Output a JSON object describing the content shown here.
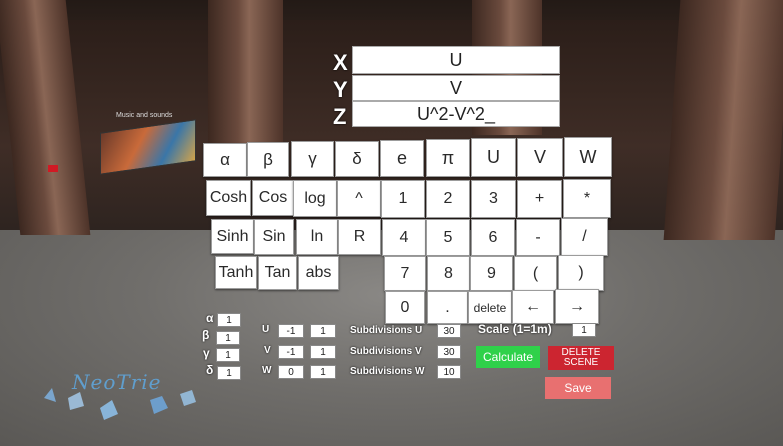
{
  "music_panel": {
    "title": "Music and sounds"
  },
  "fields": {
    "x": {
      "label": "X",
      "value": "U"
    },
    "y": {
      "label": "Y",
      "value": "V"
    },
    "z": {
      "label": "Z",
      "value": "U^2-V^2_"
    }
  },
  "keypad": {
    "row1": [
      "α",
      "β",
      "γ",
      "δ",
      "e",
      "π",
      "U",
      "V",
      "W"
    ],
    "row2": [
      "Cosh",
      "Cos",
      "log",
      "^",
      "1",
      "2",
      "3",
      "+",
      "*"
    ],
    "row3": [
      "Sinh",
      "Sin",
      "ln",
      "R",
      "4",
      "5",
      "6",
      "-",
      "/"
    ],
    "row4": [
      "Tanh",
      "Tan",
      "abs",
      "7",
      "8",
      "9",
      "(",
      ")"
    ],
    "row5": [
      "0",
      ".",
      "delete",
      "←",
      "→"
    ]
  },
  "params": {
    "greek": [
      {
        "symbol": "α",
        "value": "1"
      },
      {
        "symbol": "β",
        "value": "1"
      },
      {
        "symbol": "γ",
        "value": "1"
      },
      {
        "symbol": "δ",
        "value": "1"
      }
    ],
    "ranges": [
      {
        "var": "U",
        "min": "-1",
        "max": "1",
        "sub_label": "Subdivisions U",
        "sub": "30"
      },
      {
        "var": "V",
        "min": "-1",
        "max": "1",
        "sub_label": "Subdivisions V",
        "sub": "30"
      },
      {
        "var": "W",
        "min": "0",
        "max": "1",
        "sub_label": "Subdivisions W",
        "sub": "10"
      }
    ],
    "scale_label": "Scale (1=1m)",
    "scale": "1"
  },
  "actions": {
    "calculate": "Calculate",
    "delete_scene": "DELETE SCENE",
    "save": "Save"
  },
  "colors": {
    "calculate": "#2fd14a",
    "delete_scene": "#cc2530",
    "save": "#e87070"
  },
  "logo": {
    "text": "NeoTrie"
  }
}
